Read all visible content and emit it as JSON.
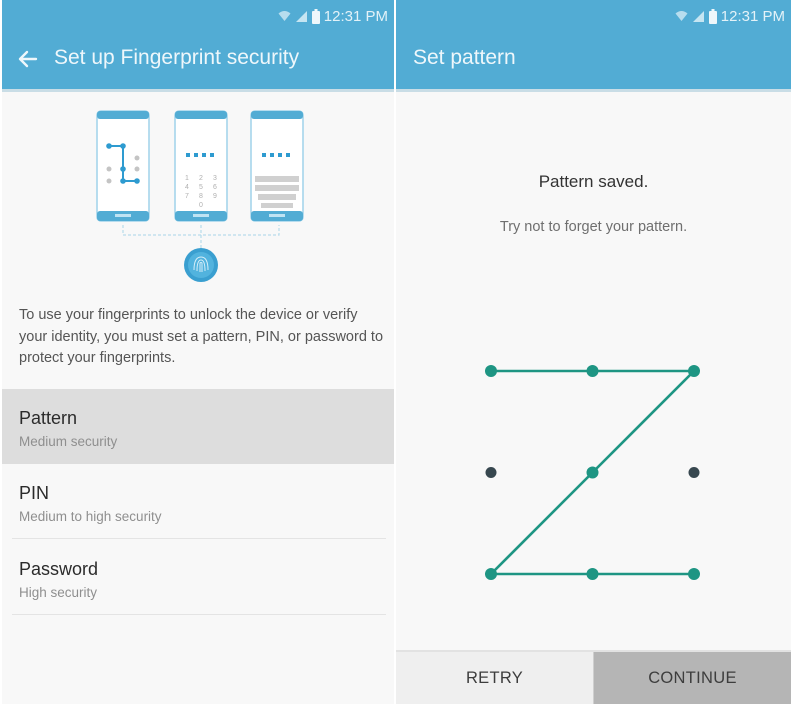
{
  "colors": {
    "appbar": "#52acd4",
    "accent_teal": "#1e9583",
    "inactive_dot": "#37474f",
    "selected_row": "#dddddd"
  },
  "status_bar": {
    "icons": [
      "wifi-icon",
      "signal-icon",
      "battery-icon"
    ],
    "time": "12:31 PM"
  },
  "left_screen": {
    "title": "Set up Fingerprint security",
    "back_icon": "arrow-left-icon",
    "illustration": {
      "phones": [
        "pattern",
        "pin",
        "password"
      ],
      "pin_keys": [
        "1",
        "2",
        "3",
        "4",
        "5",
        "6",
        "7",
        "8",
        "9",
        "0"
      ],
      "fingerprint_icon": "fingerprint-icon"
    },
    "description": "To use your fingerprints to unlock the device or verify your identity, you must set a pattern, PIN, or password to protect your fingerprints.",
    "options": [
      {
        "title": "Pattern",
        "subtitle": "Medium security",
        "selected": true
      },
      {
        "title": "PIN",
        "subtitle": "Medium to high security",
        "selected": false
      },
      {
        "title": "Password",
        "subtitle": "High security",
        "selected": false
      }
    ]
  },
  "right_screen": {
    "title": "Set pattern",
    "message_title": "Pattern saved.",
    "message_sub": "Try not to forget your pattern.",
    "pattern": {
      "grid_size": 3,
      "sequence": [
        1,
        2,
        3,
        5,
        7,
        8,
        9
      ],
      "inactive_nodes": [
        4,
        6
      ]
    },
    "buttons": {
      "retry": "RETRY",
      "continue": "CONTINUE"
    }
  }
}
